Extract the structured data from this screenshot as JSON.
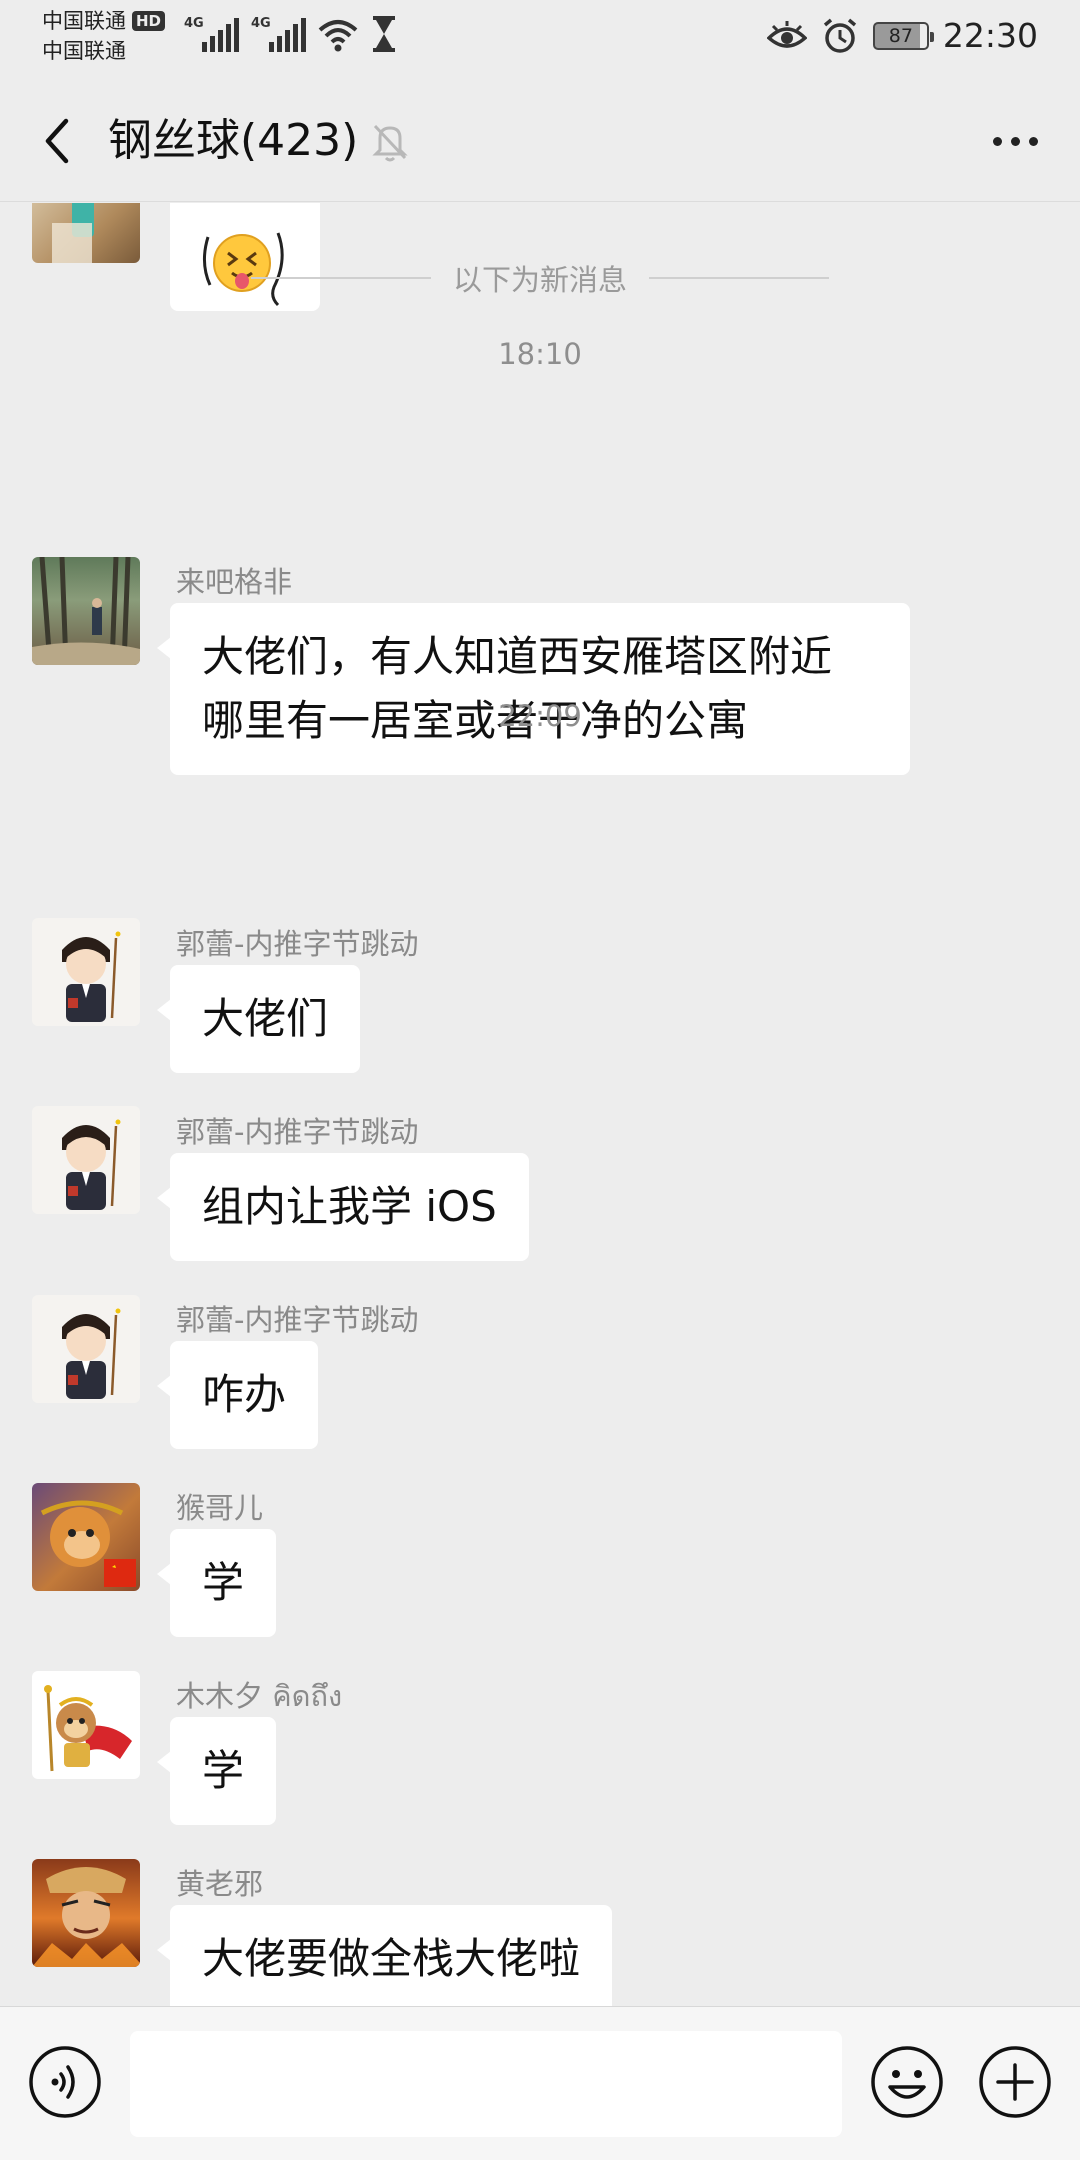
{
  "status_bar": {
    "carrier_1": "中国联通",
    "carrier_2": "中国联通",
    "hd_badge": "HD",
    "network_1": "4G",
    "network_2": "4G",
    "battery": "87",
    "time": "22:30"
  },
  "header": {
    "title": "钢丝球(423)"
  },
  "chat": {
    "new_messages_divider": "以下为新消息",
    "timestamps": [
      "18:10",
      "22:09"
    ],
    "messages": [
      {
        "sender": "",
        "text": "",
        "kind": "emoji-sticker"
      },
      {
        "sender": "来吧格非",
        "text": "大佬们，有人知道西安雁塔区附近\n哪里有一居室或者干净的公寓"
      },
      {
        "sender": "郭蕾-内推字节跳动",
        "text": "大佬们"
      },
      {
        "sender": "郭蕾-内推字节跳动",
        "text": "组内让我学 iOS"
      },
      {
        "sender": "郭蕾-内推字节跳动",
        "text": "咋办"
      },
      {
        "sender": "猴哥儿",
        "text": "学"
      },
      {
        "sender": "木木夕 คิดถึง",
        "text": "学"
      },
      {
        "sender": "黄老邪",
        "text": "大佬要做全栈大佬啦"
      }
    ]
  },
  "input_bar": {
    "placeholder": ""
  },
  "colors": {
    "background": "#ededed",
    "bubble": "#ffffff",
    "meta_text": "#8a8a8a"
  }
}
